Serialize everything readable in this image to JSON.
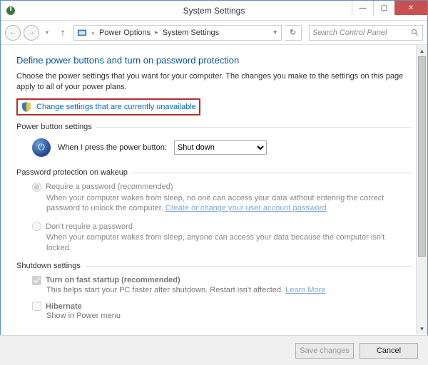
{
  "window": {
    "title": "System Settings"
  },
  "breadcrumb": {
    "root_sep": "«",
    "item1": "Power Options",
    "item2": "System Settings"
  },
  "search": {
    "placeholder": "Search Control Panel"
  },
  "page": {
    "heading": "Define power buttons and turn on password protection",
    "description": "Choose the power settings that you want for your computer. The changes you make to the settings on this page apply to all of your power plans.",
    "change_link": "Change settings that are currently unavailable"
  },
  "power_button": {
    "section": "Power button settings",
    "label": "When I press the power button:",
    "selected": "Shut down"
  },
  "password": {
    "section": "Password protection on wakeup",
    "opt_require": "Require a password (recommended)",
    "opt_require_desc_a": "When your computer wakes from sleep, no one can access your data without entering the correct password to unlock the computer. ",
    "opt_require_link": "Create or change your user account password",
    "opt_no": "Don't require a password",
    "opt_no_desc": "When your computer wakes from sleep, anyone can access your data because the computer isn't locked."
  },
  "shutdown": {
    "section": "Shutdown settings",
    "fast_label": "Turn on fast startup (recommended)",
    "fast_desc": "This helps start your PC faster after shutdown. Restart isn't affected. ",
    "fast_link": "Learn More",
    "hibernate_label": "Hibernate",
    "hibernate_desc": "Show in Power menu"
  },
  "footer": {
    "save": "Save changes",
    "cancel": "Cancel"
  }
}
